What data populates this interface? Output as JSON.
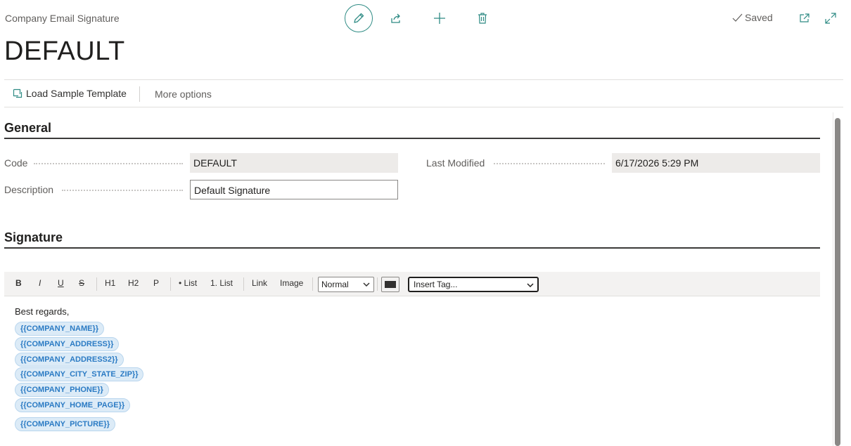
{
  "header": {
    "breadcrumb": "Company Email Signature",
    "saved_label": "Saved",
    "title": "DEFAULT"
  },
  "icons": {
    "edit": "pencil-icon",
    "share": "share-icon",
    "new": "plus-icon",
    "delete": "trash-icon",
    "saved": "checkmark-icon",
    "open_new": "open-in-new-window-icon",
    "expand": "expand-icon",
    "load": "template-icon",
    "accent_color": "#2e8b84"
  },
  "actions": {
    "load_sample": "Load Sample Template",
    "more_options": "More options"
  },
  "general": {
    "section_title": "General",
    "code_label": "Code",
    "code_value": "DEFAULT",
    "description_label": "Description",
    "description_value": "Default Signature",
    "last_modified_label": "Last Modified",
    "last_modified_value": "6/17/2026 5:29 PM"
  },
  "signature": {
    "section_title": "Signature",
    "toolbar": {
      "bold": "B",
      "italic": "I",
      "underline": "U",
      "strike": "S",
      "h1": "H1",
      "h2": "H2",
      "p": "P",
      "bullet_list": "• List",
      "numbered_list": "1. List",
      "link": "Link",
      "image": "Image",
      "format_select": "Normal",
      "insert_tag_select": "Insert Tag..."
    },
    "greeting": "Best regards,",
    "tags": [
      "{{COMPANY_NAME}}",
      "{{COMPANY_ADDRESS}}",
      "{{COMPANY_ADDRESS2}}",
      "{{COMPANY_CITY_STATE_ZIP}}",
      "{{COMPANY_PHONE}}",
      "{{COMPANY_HOME_PAGE}}",
      "{{COMPANY_PICTURE}}"
    ],
    "tag_color": "#2b7bc4"
  }
}
